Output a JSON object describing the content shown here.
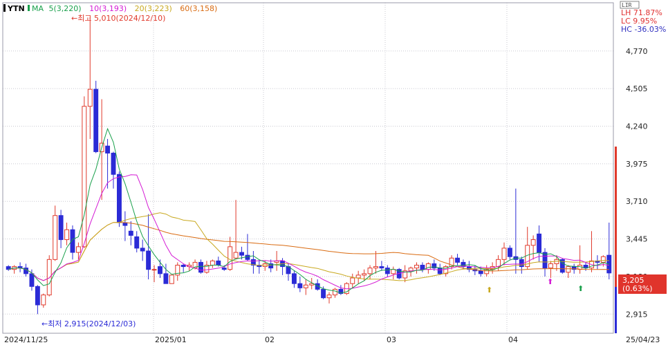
{
  "header": {
    "symbol": "YTN",
    "ma_label": "MA",
    "ma_items": [
      {
        "text": "5(3,220)",
        "color": "#19a04b"
      },
      {
        "text": "10(3,193)",
        "color": "#d41ad4"
      },
      {
        "text": "20(3,223)",
        "color": "#c8a81e"
      },
      {
        "text": "60(3,158)",
        "color": "#d96a10"
      }
    ]
  },
  "stats": [
    {
      "text": "LH  71.87%",
      "color": "#e03030"
    },
    {
      "text": "LC   9.95%",
      "color": "#e03030"
    },
    {
      "text": "HC -36.03%",
      "color": "#3030c0"
    }
  ],
  "lir_label": "LIR",
  "annotations": {
    "high": "←최고 5,010(2024/12/10)",
    "low": "←최저 2,915(2024/12/03)"
  },
  "price_tag": {
    "price": "3,205",
    "change": "(0.63%)"
  },
  "colors": {
    "up": "#e0392b",
    "down": "#2b2bd6",
    "ma5": "#19a04b",
    "ma10": "#d41ad4",
    "ma20": "#c8a81e",
    "ma60": "#d96a10",
    "grid": "#c8c8d0",
    "tag_bg": "#e0342c"
  },
  "chart_data": {
    "type": "candlestick",
    "title": "YTN",
    "x_labels": [
      "2024/11/25",
      "2025/01",
      "02",
      "03",
      "04",
      "25/04/23"
    ],
    "y_ticks": [
      2915,
      3180,
      3445,
      3710,
      3975,
      4240,
      4505,
      4770
    ],
    "y_tick_labels": [
      "2,915",
      "3,180",
      "3,445",
      "3,710",
      "3,975",
      "4,240",
      "4,505",
      "4,770"
    ],
    "ylim": [
      2780,
      5110
    ],
    "last_price": 3205,
    "last_change_pct": 0.63,
    "high": {
      "value": 5010,
      "date": "2024/12/10"
    },
    "low": {
      "value": 2915,
      "date": "2024/12/03"
    },
    "candles": [
      [
        3250,
        3260,
        3220,
        3230
      ],
      [
        3230,
        3260,
        3200,
        3250
      ],
      [
        3250,
        3280,
        3210,
        3240
      ],
      [
        3240,
        3270,
        3180,
        3200
      ],
      [
        3200,
        3230,
        3080,
        3110
      ],
      [
        3110,
        3120,
        2915,
        2980
      ],
      [
        2980,
        3060,
        2960,
        3050
      ],
      [
        3050,
        3330,
        3040,
        3300
      ],
      [
        3300,
        3680,
        3290,
        3610
      ],
      [
        3610,
        3650,
        3380,
        3440
      ],
      [
        3440,
        3560,
        3400,
        3510
      ],
      [
        3510,
        3540,
        3300,
        3350
      ],
      [
        3350,
        3420,
        3300,
        3390
      ],
      [
        3390,
        4450,
        3380,
        4380
      ],
      [
        4380,
        5010,
        4150,
        4500
      ],
      [
        4500,
        4560,
        4050,
        4060
      ],
      [
        4060,
        4430,
        3720,
        4120
      ],
      [
        4100,
        4150,
        3800,
        4050
      ],
      [
        4050,
        4060,
        3800,
        3900
      ],
      [
        3900,
        3920,
        3530,
        3560
      ],
      [
        3560,
        3640,
        3430,
        3540
      ],
      [
        3500,
        3570,
        3400,
        3470
      ],
      [
        3460,
        3500,
        3350,
        3380
      ],
      [
        3380,
        3440,
        3290,
        3360
      ],
      [
        3360,
        3620,
        3160,
        3230
      ],
      [
        3230,
        3260,
        3140,
        3230
      ],
      [
        3250,
        3300,
        3170,
        3200
      ],
      [
        3200,
        3270,
        3140,
        3130
      ],
      [
        3130,
        3180,
        3130,
        3190
      ],
      [
        3190,
        3280,
        3150,
        3260
      ],
      [
        3260,
        3270,
        3210,
        3250
      ],
      [
        3250,
        3280,
        3220,
        3260
      ],
      [
        3240,
        3300,
        3230,
        3280
      ],
      [
        3280,
        3300,
        3200,
        3210
      ],
      [
        3210,
        3290,
        3200,
        3260
      ],
      [
        3260,
        3300,
        3240,
        3290
      ],
      [
        3290,
        3320,
        3250,
        3260
      ],
      [
        3240,
        3260,
        3220,
        3230
      ],
      [
        3230,
        3460,
        3220,
        3390
      ],
      [
        3310,
        3720,
        3300,
        3350
      ],
      [
        3350,
        3390,
        3300,
        3330
      ],
      [
        3330,
        3480,
        3290,
        3300
      ],
      [
        3300,
        3360,
        3200,
        3260
      ],
      [
        3260,
        3300,
        3200,
        3250
      ],
      [
        3250,
        3290,
        3220,
        3270
      ],
      [
        3270,
        3300,
        3210,
        3240
      ],
      [
        3280,
        3360,
        3220,
        3290
      ],
      [
        3290,
        3310,
        3190,
        3250
      ],
      [
        3250,
        3270,
        3150,
        3200
      ],
      [
        3200,
        3220,
        3100,
        3130
      ],
      [
        3130,
        3180,
        3070,
        3100
      ],
      [
        3100,
        3160,
        3050,
        3120
      ],
      [
        3120,
        3170,
        3090,
        3130
      ],
      [
        3130,
        3160,
        3080,
        3090
      ],
      [
        3090,
        3110,
        3020,
        3030
      ],
      [
        3030,
        3070,
        2990,
        3050
      ],
      [
        3050,
        3100,
        3030,
        3090
      ],
      [
        3090,
        3120,
        3050,
        3060
      ],
      [
        3060,
        3140,
        3050,
        3130
      ],
      [
        3130,
        3200,
        3100,
        3170
      ],
      [
        3170,
        3220,
        3130,
        3190
      ],
      [
        3190,
        3230,
        3150,
        3200
      ],
      [
        3200,
        3260,
        3160,
        3240
      ],
      [
        3240,
        3360,
        3200,
        3250
      ],
      [
        3250,
        3290,
        3220,
        3240
      ],
      [
        3240,
        3260,
        3180,
        3200
      ],
      [
        3200,
        3250,
        3160,
        3230
      ],
      [
        3230,
        3240,
        3160,
        3170
      ],
      [
        3170,
        3260,
        3140,
        3220
      ],
      [
        3220,
        3250,
        3180,
        3240
      ],
      [
        3240,
        3280,
        3200,
        3260
      ],
      [
        3260,
        3280,
        3210,
        3230
      ],
      [
        3230,
        3280,
        3200,
        3270
      ],
      [
        3270,
        3300,
        3220,
        3240
      ],
      [
        3240,
        3270,
        3190,
        3200
      ],
      [
        3200,
        3260,
        3180,
        3250
      ],
      [
        3250,
        3330,
        3230,
        3310
      ],
      [
        3310,
        3340,
        3260,
        3280
      ],
      [
        3280,
        3300,
        3230,
        3250
      ],
      [
        3250,
        3290,
        3210,
        3230
      ],
      [
        3230,
        3260,
        3190,
        3220
      ],
      [
        3220,
        3250,
        3180,
        3200
      ],
      [
        3200,
        3260,
        3180,
        3230
      ],
      [
        3230,
        3280,
        3200,
        3250
      ],
      [
        3250,
        3330,
        3220,
        3300
      ],
      [
        3300,
        3420,
        3260,
        3380
      ],
      [
        3380,
        3400,
        3300,
        3320
      ],
      [
        3320,
        3800,
        3200,
        3300
      ],
      [
        3300,
        3320,
        3200,
        3250
      ],
      [
        3250,
        3530,
        3230,
        3400
      ],
      [
        3400,
        3470,
        3300,
        3440
      ],
      [
        3480,
        3540,
        3280,
        3350
      ],
      [
        3350,
        3380,
        3180,
        3240
      ],
      [
        3240,
        3290,
        3170,
        3270
      ],
      [
        3270,
        3330,
        3220,
        3300
      ],
      [
        3300,
        3310,
        3200,
        3210
      ],
      [
        3210,
        3260,
        3170,
        3250
      ],
      [
        3250,
        3270,
        3200,
        3230
      ],
      [
        3230,
        3400,
        3200,
        3260
      ],
      [
        3260,
        3280,
        3220,
        3240
      ],
      [
        3240,
        3500,
        3210,
        3290
      ],
      [
        3290,
        3330,
        3230,
        3280
      ],
      [
        3280,
        3330,
        3250,
        3320
      ],
      [
        3330,
        3560,
        3160,
        3205
      ]
    ]
  }
}
